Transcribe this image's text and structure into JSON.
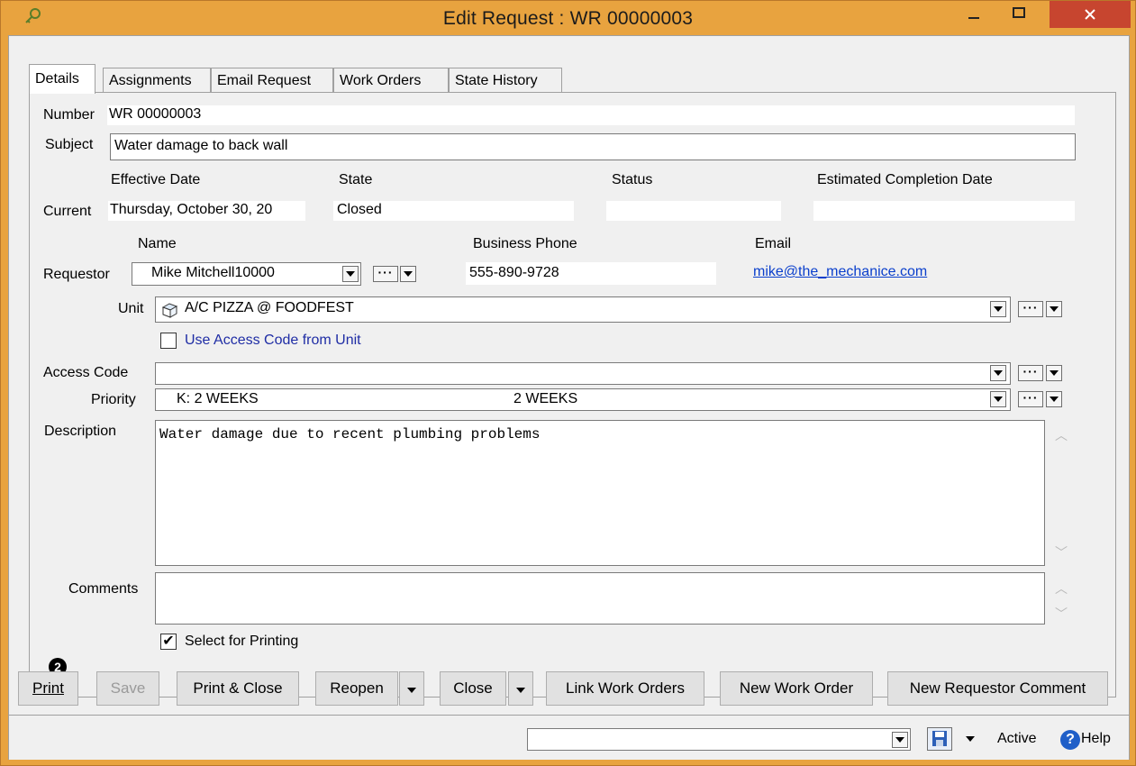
{
  "window": {
    "title": "Edit Request : WR 00000003",
    "accent_color": "#e8a33f",
    "close_color": "#c7452f"
  },
  "tabs": [
    "Details",
    "Assignments",
    "Email Request",
    "Work Orders",
    "State History"
  ],
  "details": {
    "number_label": "Number",
    "number_value": "WR 00000003",
    "subject_label": "Subject",
    "subject_value": "Water damage to back wall",
    "effective_date_header": "Effective Date",
    "state_header": "State",
    "status_header": "Status",
    "est_completion_header": "Estimated Completion Date",
    "current_label": "Current",
    "effective_date_value": "Thursday, October 30, 20",
    "state_value": "Closed",
    "status_value": "",
    "est_completion_value": "",
    "name_header": "Name",
    "business_phone_header": "Business Phone",
    "email_header": "Email",
    "requestor_label": "Requestor",
    "requestor_name": "Mike Mitchell10000",
    "business_phone": "555-890-9728",
    "email": "mike@the_mechanice.com",
    "unit_label": "Unit",
    "unit_value": "A/C PIZZA @ FOODFEST",
    "use_access_code_label": "Use Access Code from Unit",
    "use_access_code_checked": false,
    "access_code_label": "Access Code",
    "access_code_value": "",
    "priority_label": "Priority",
    "priority_code": "K: 2 WEEKS",
    "priority_desc": "2 WEEKS",
    "description_label": "Description",
    "description_value": "Water damage due to recent plumbing problems",
    "comments_label": "Comments",
    "comments_value": "",
    "select_for_printing_label": "Select for Printing",
    "select_for_printing_checked": true
  },
  "buttons": {
    "print": "Print",
    "save": "Save",
    "print_close": "Print & Close",
    "reopen": "Reopen",
    "close": "Close",
    "link_work_orders": "Link Work Orders",
    "new_work_order": "New Work Order",
    "new_requestor_comment": "New Requestor Comment"
  },
  "badge": "2",
  "statusbar": {
    "dropdown_value": "",
    "active_label": "Active",
    "help_label": "Help"
  },
  "icons": [
    "app-key-icon",
    "minimize-icon",
    "maximize-icon",
    "close-icon",
    "box-unit-icon",
    "save-disk-icon",
    "help-icon",
    "dropdown-arrow-icon",
    "ellipsis-icon",
    "scroll-up-icon",
    "scroll-down-icon",
    "checkmark-icon"
  ]
}
